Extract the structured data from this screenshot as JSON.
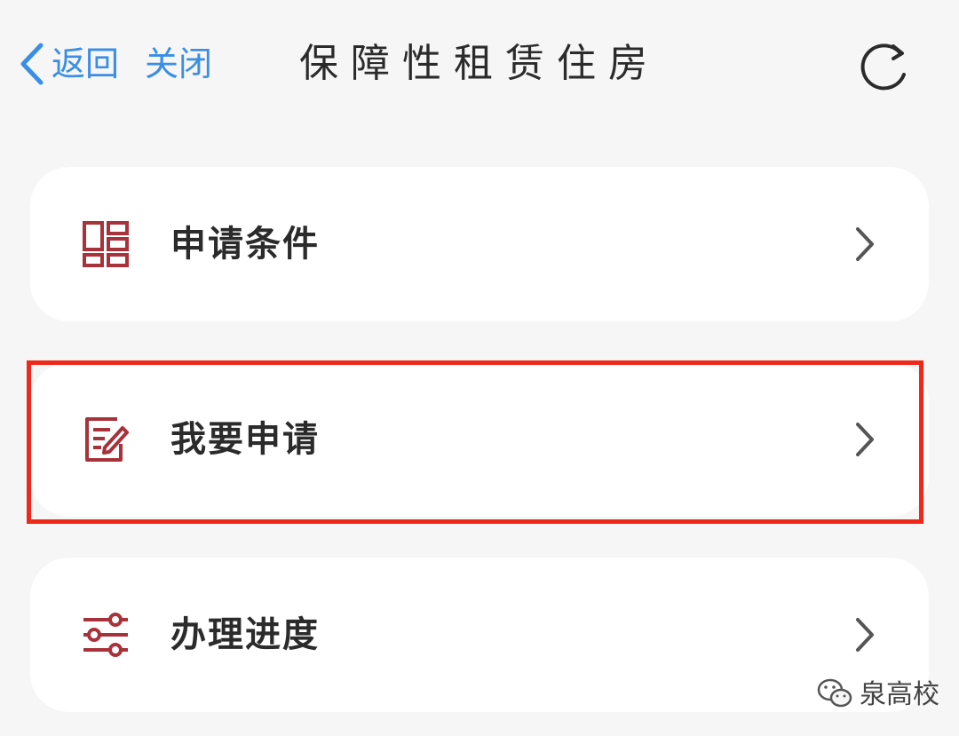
{
  "header": {
    "back_label": "返回",
    "close_label": "关闭",
    "title": "保障性租赁住房",
    "back_icon": "chevron-left-icon",
    "refresh_icon": "refresh-icon"
  },
  "menu": {
    "items": [
      {
        "label": "申请条件",
        "icon": "grid-layout-icon"
      },
      {
        "label": "我要申请",
        "icon": "edit-form-icon"
      },
      {
        "label": "办理进度",
        "icon": "sliders-icon"
      }
    ]
  },
  "watermark": {
    "text": "泉高校",
    "icon": "wechat-icon"
  },
  "colors": {
    "link": "#3a8ee6",
    "icon_accent": "#a8323a",
    "highlight": "#f0281a",
    "text": "#2b2b2b",
    "background": "#f6f6f6",
    "card": "#ffffff"
  }
}
